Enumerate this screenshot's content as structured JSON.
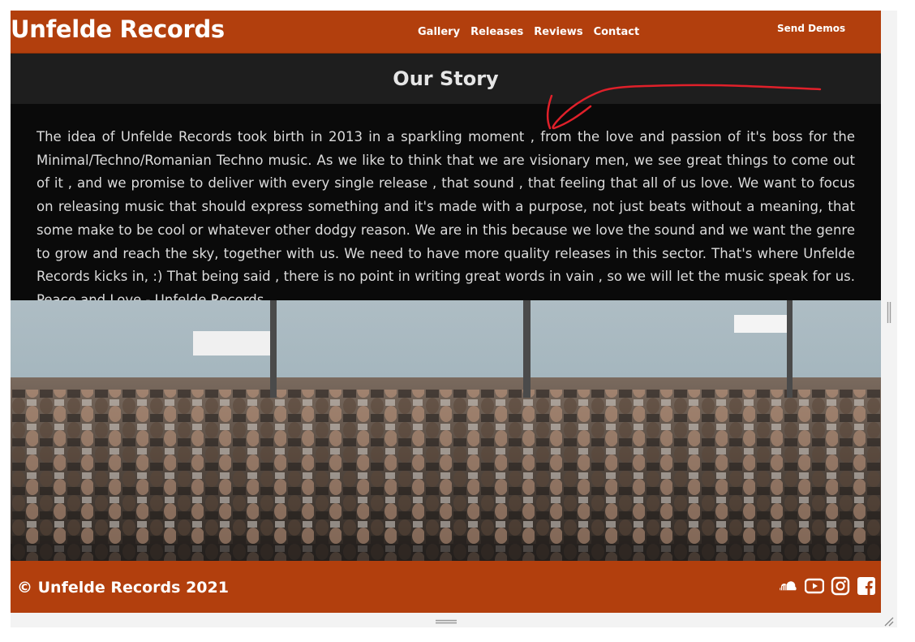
{
  "header": {
    "brand": "Unfelde Records",
    "nav": [
      "Gallery",
      "Releases",
      "Reviews",
      "Contact"
    ],
    "send_demos": "Send Demos"
  },
  "story": {
    "title": "Our Story",
    "body": "The idea of Unfelde Records took birth in 2013 in a sparkling moment , from the love and passion of it's boss for the Minimal/Techno/Romanian Techno music. As we like to think that we are visionary men, we see great things to come out of it , and we promise to deliver with every single release , that sound , that feeling that all of us love. We want to focus on releasing music that should express something and it's made with a purpose, not just beats without a meaning, that some make to be cool or whatever other dodgy reason. We are in this because we love the sound and we want the genre to grow and reach the sky, together with us. We need to have more quality releases in this sector. That's where Unfelde Records kicks in, :) That being said , there is no point in writing great words in vain , so we will let the music speak for us. Peace and Love - Unfelde Records"
  },
  "footer": {
    "copyright": "© Unfelde Records 2021",
    "social_icons": [
      "soundcloud-icon",
      "youtube-icon",
      "instagram-icon",
      "facebook-icon"
    ]
  },
  "colors": {
    "accent": "#b23f0d",
    "story_bar": "#1e1e1e",
    "body_bg": "#0a0a0a",
    "annotation": "#e0202a"
  }
}
